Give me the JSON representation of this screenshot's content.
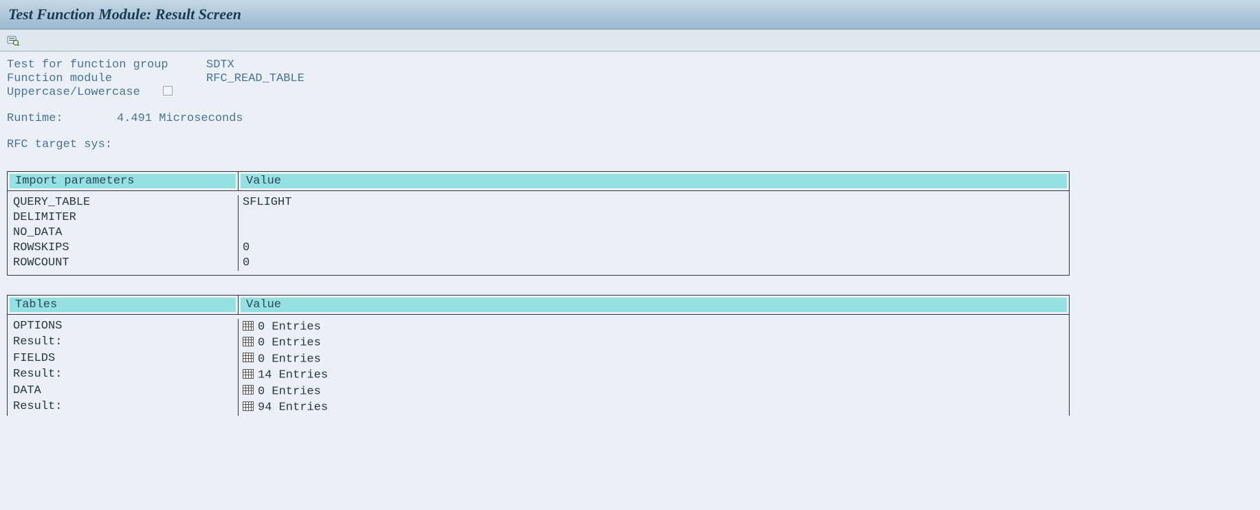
{
  "title": "Test Function Module: Result Screen",
  "info": {
    "test_group_label": "Test for function group",
    "test_group_value": "SDTX",
    "function_module_label": "Function module",
    "function_module_value": "RFC_READ_TABLE",
    "case_label": "Uppercase/Lowercase",
    "runtime_label": "Runtime:",
    "runtime_value": "4.491 Microseconds",
    "rfc_label": "RFC target sys:"
  },
  "import_table": {
    "col1": "Import parameters",
    "col2": "Value",
    "rows": [
      {
        "name": "QUERY_TABLE",
        "value": "SFLIGHT"
      },
      {
        "name": "DELIMITER",
        "value": ""
      },
      {
        "name": "NO_DATA",
        "value": ""
      },
      {
        "name": "ROWSKIPS",
        "value": "0"
      },
      {
        "name": "ROWCOUNT",
        "value": "0"
      }
    ]
  },
  "tables_table": {
    "col1": "Tables",
    "col2": "Value",
    "result_label": "Result:",
    "rows": [
      {
        "name": "OPTIONS",
        "entries": "0 Entries",
        "result_entries": "0 Entries"
      },
      {
        "name": "FIELDS",
        "entries": "0 Entries",
        "result_entries": "14 Entries"
      },
      {
        "name": "DATA",
        "entries": "0 Entries",
        "result_entries": "94 Entries"
      }
    ]
  }
}
